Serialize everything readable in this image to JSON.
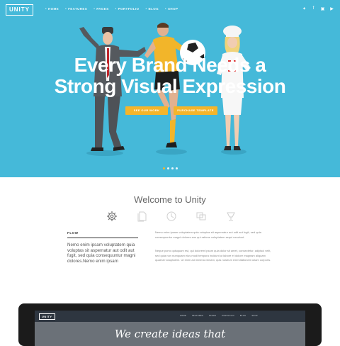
{
  "header": {
    "logo": "UNITY",
    "nav": [
      "HOME",
      "FEATURES",
      "PAGES",
      "PORTFOLIO",
      "BLOG",
      "SHOP"
    ],
    "social_icons": [
      "twitter-icon",
      "facebook-icon",
      "instagram-icon",
      "youtube-icon"
    ]
  },
  "hero": {
    "headline_line1": "Every Brand Needs a",
    "headline_line2": "Strong Visual Expression",
    "cta_primary": "SEE OUR WORK",
    "cta_secondary": "PURCHASE TEMPLATE",
    "slides": 4,
    "active_slide": 1
  },
  "welcome": {
    "title": "Welcome to Unity",
    "feature_icons": [
      "gear-icon",
      "documents-icon",
      "clock-icon",
      "windows-icon",
      "trophy-icon"
    ],
    "section_label": "FLOW",
    "intro": "Nemo enim ipsam voluptatem quia voluptas sit aspernatur aut odit aut fugit, sed quia consequuntur magni dolores.Nemo enim ipsam",
    "paragraph1": "Nemo enim ipsam voluptatem quia voluptas sit aspernatur aut odit aut fugit, sed quia consequuntur magni dolores eos qui ratione voluptatem sequi nesciunt.",
    "paragraph2": "Neque porro quisquam est, qui dolorem ipsum quia dolor sit amet, consectetur, adipisci velit, sed quia non numquam eius modi tempora incidunt ut labore et dolore magnam aliquam quaerat voluptatem. Ut enim ad minima veniam, quis nostrum exercitationem ullam corporis."
  },
  "device": {
    "logo": "UNITY",
    "nav": [
      "HOME",
      "FEATURES",
      "PAGES",
      "PORTFOLIO",
      "BLOG",
      "SHOP"
    ],
    "headline": "We create ideas that"
  },
  "colors": {
    "hero_bg": "#45b9d9",
    "accent": "#f5b52a",
    "device_frame": "#1b1b1b"
  }
}
